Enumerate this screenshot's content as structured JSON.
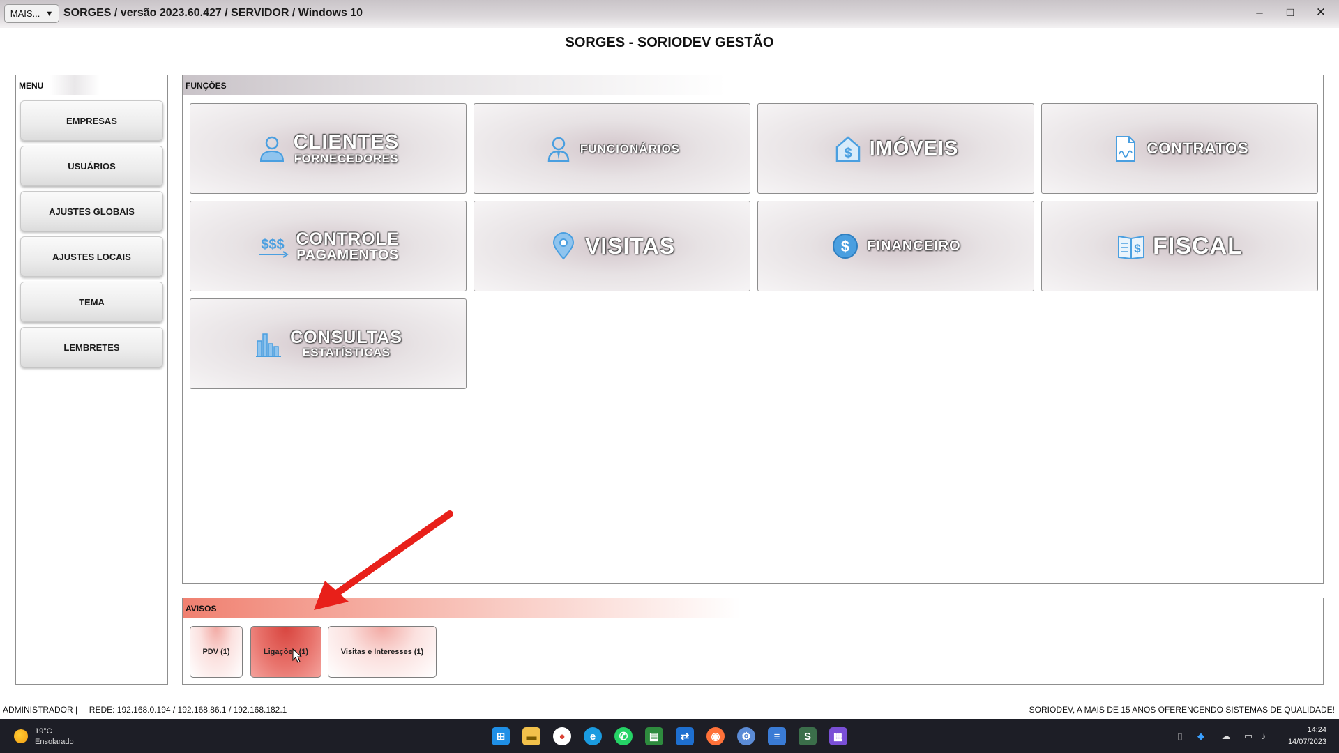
{
  "window": {
    "mais_label": "MAIS...",
    "mais_arrow": "▼",
    "title": "SORGES / versão 2023.60.427 / SERVIDOR / Windows 10",
    "minimize": "–",
    "maximize": "□",
    "close": "✕"
  },
  "header": {
    "title": "SORGES - SORIODEV GESTÃO"
  },
  "menu": {
    "label": "MENU",
    "items": [
      {
        "label": "EMPRESAS"
      },
      {
        "label": "USUÁRIOS"
      },
      {
        "label": "AJUSTES GLOBAIS"
      },
      {
        "label": "AJUSTES LOCAIS"
      },
      {
        "label": "TEMA"
      },
      {
        "label": "LEMBRETES"
      }
    ]
  },
  "functions": {
    "label": "FUNÇÕES",
    "tiles": [
      {
        "title": "CLIENTES",
        "subtitle": "FORNECEDORES",
        "icon": "person-icon"
      },
      {
        "title": "FUNCIONÁRIOS",
        "icon": "employee-icon"
      },
      {
        "title": "IMÓVEIS",
        "icon": "house-dollar-icon"
      },
      {
        "title": "CONTRATOS",
        "icon": "document-signature-icon"
      },
      {
        "title": "CONTROLE",
        "subtitle": "PAGAMENTOS",
        "icon": "dollars-icon"
      },
      {
        "title": "VISITAS",
        "icon": "location-pin-icon"
      },
      {
        "title": "FINANCEIRO",
        "icon": "dollar-coin-icon"
      },
      {
        "title": "FISCAL",
        "icon": "book-dollar-icon"
      },
      {
        "title": "CONSULTAS",
        "subtitle": "ESTATÍSTICAS",
        "icon": "bar-chart-icon"
      }
    ]
  },
  "avisos": {
    "label": "AVISOS",
    "buttons": [
      {
        "label": "PDV (1)"
      },
      {
        "label": "Ligações (1)"
      },
      {
        "label": "Visitas e Interesses (1)"
      }
    ]
  },
  "status": {
    "left": "ADMINISTRADOR |     REDE: 192.168.0.194 / 192.168.86.1 / 192.168.182.1",
    "right": "SORIODEV, A MAIS DE 15 ANOS OFERENCENDO SISTEMAS DE QUALIDADE!"
  },
  "taskbar": {
    "weather_temp": "19°C",
    "weather_condition": "Ensolarado",
    "time": "14:24",
    "date": "14/07/2023"
  },
  "colors": {
    "accent_blue": "#4a9fe0",
    "avisos_red": "#e8726b",
    "arrow_red": "#e8201a"
  }
}
